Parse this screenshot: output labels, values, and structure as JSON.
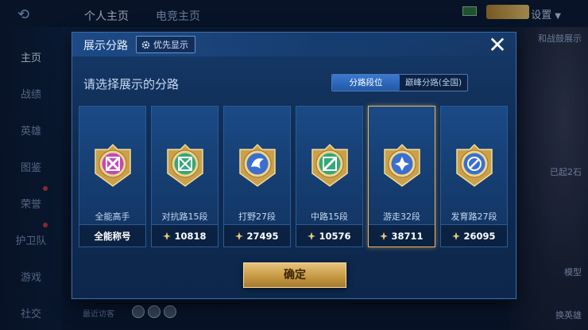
{
  "background": {
    "tabs": [
      "个人主页",
      "电竞主页"
    ],
    "settings_label": "设置",
    "sidebar": [
      "主页",
      "战绩",
      "英雄",
      "图鉴",
      "荣誉",
      "护卫队",
      "游戏",
      "社交"
    ],
    "right_labels": [
      "和战鼓展示",
      "已起2石",
      "模型",
      "换英雄"
    ],
    "recent_label": "最近访客"
  },
  "modal": {
    "title": "展示分路",
    "priority_label": "优先显示",
    "subtitle": "请选择展示的分路",
    "toggle": {
      "options": [
        "分路段位",
        "巅峰分路(全国)"
      ],
      "active_index": 0
    },
    "cards": [
      {
        "name": "全能高手",
        "score": "全能称号",
        "emblem_color": "#c548b9",
        "selected": false,
        "has_icon": false
      },
      {
        "name": "对抗路15段",
        "score": "10818",
        "emblem_color": "#35a878",
        "selected": false,
        "has_icon": true
      },
      {
        "name": "打野27段",
        "score": "27495",
        "emblem_color": "#3a6fd0",
        "selected": false,
        "has_icon": true
      },
      {
        "name": "中路15段",
        "score": "10576",
        "emblem_color": "#35a878",
        "selected": false,
        "has_icon": true
      },
      {
        "name": "游走32段",
        "score": "38711",
        "emblem_color": "#3a6fd0",
        "selected": true,
        "has_icon": true
      },
      {
        "name": "发育路27段",
        "score": "26095",
        "emblem_color": "#3a6fd0",
        "selected": false,
        "has_icon": true
      }
    ],
    "confirm_label": "确定"
  }
}
